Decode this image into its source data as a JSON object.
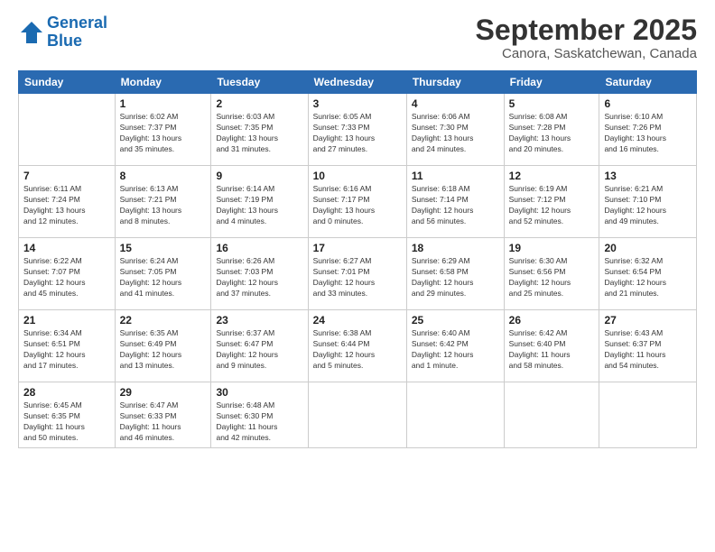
{
  "logo": {
    "line1": "General",
    "line2": "Blue"
  },
  "title": "September 2025",
  "location": "Canora, Saskatchewan, Canada",
  "weekdays": [
    "Sunday",
    "Monday",
    "Tuesday",
    "Wednesday",
    "Thursday",
    "Friday",
    "Saturday"
  ],
  "weeks": [
    [
      {
        "day": "",
        "info": ""
      },
      {
        "day": "1",
        "info": "Sunrise: 6:02 AM\nSunset: 7:37 PM\nDaylight: 13 hours\nand 35 minutes."
      },
      {
        "day": "2",
        "info": "Sunrise: 6:03 AM\nSunset: 7:35 PM\nDaylight: 13 hours\nand 31 minutes."
      },
      {
        "day": "3",
        "info": "Sunrise: 6:05 AM\nSunset: 7:33 PM\nDaylight: 13 hours\nand 27 minutes."
      },
      {
        "day": "4",
        "info": "Sunrise: 6:06 AM\nSunset: 7:30 PM\nDaylight: 13 hours\nand 24 minutes."
      },
      {
        "day": "5",
        "info": "Sunrise: 6:08 AM\nSunset: 7:28 PM\nDaylight: 13 hours\nand 20 minutes."
      },
      {
        "day": "6",
        "info": "Sunrise: 6:10 AM\nSunset: 7:26 PM\nDaylight: 13 hours\nand 16 minutes."
      }
    ],
    [
      {
        "day": "7",
        "info": "Sunrise: 6:11 AM\nSunset: 7:24 PM\nDaylight: 13 hours\nand 12 minutes."
      },
      {
        "day": "8",
        "info": "Sunrise: 6:13 AM\nSunset: 7:21 PM\nDaylight: 13 hours\nand 8 minutes."
      },
      {
        "day": "9",
        "info": "Sunrise: 6:14 AM\nSunset: 7:19 PM\nDaylight: 13 hours\nand 4 minutes."
      },
      {
        "day": "10",
        "info": "Sunrise: 6:16 AM\nSunset: 7:17 PM\nDaylight: 13 hours\nand 0 minutes."
      },
      {
        "day": "11",
        "info": "Sunrise: 6:18 AM\nSunset: 7:14 PM\nDaylight: 12 hours\nand 56 minutes."
      },
      {
        "day": "12",
        "info": "Sunrise: 6:19 AM\nSunset: 7:12 PM\nDaylight: 12 hours\nand 52 minutes."
      },
      {
        "day": "13",
        "info": "Sunrise: 6:21 AM\nSunset: 7:10 PM\nDaylight: 12 hours\nand 49 minutes."
      }
    ],
    [
      {
        "day": "14",
        "info": "Sunrise: 6:22 AM\nSunset: 7:07 PM\nDaylight: 12 hours\nand 45 minutes."
      },
      {
        "day": "15",
        "info": "Sunrise: 6:24 AM\nSunset: 7:05 PM\nDaylight: 12 hours\nand 41 minutes."
      },
      {
        "day": "16",
        "info": "Sunrise: 6:26 AM\nSunset: 7:03 PM\nDaylight: 12 hours\nand 37 minutes."
      },
      {
        "day": "17",
        "info": "Sunrise: 6:27 AM\nSunset: 7:01 PM\nDaylight: 12 hours\nand 33 minutes."
      },
      {
        "day": "18",
        "info": "Sunrise: 6:29 AM\nSunset: 6:58 PM\nDaylight: 12 hours\nand 29 minutes."
      },
      {
        "day": "19",
        "info": "Sunrise: 6:30 AM\nSunset: 6:56 PM\nDaylight: 12 hours\nand 25 minutes."
      },
      {
        "day": "20",
        "info": "Sunrise: 6:32 AM\nSunset: 6:54 PM\nDaylight: 12 hours\nand 21 minutes."
      }
    ],
    [
      {
        "day": "21",
        "info": "Sunrise: 6:34 AM\nSunset: 6:51 PM\nDaylight: 12 hours\nand 17 minutes."
      },
      {
        "day": "22",
        "info": "Sunrise: 6:35 AM\nSunset: 6:49 PM\nDaylight: 12 hours\nand 13 minutes."
      },
      {
        "day": "23",
        "info": "Sunrise: 6:37 AM\nSunset: 6:47 PM\nDaylight: 12 hours\nand 9 minutes."
      },
      {
        "day": "24",
        "info": "Sunrise: 6:38 AM\nSunset: 6:44 PM\nDaylight: 12 hours\nand 5 minutes."
      },
      {
        "day": "25",
        "info": "Sunrise: 6:40 AM\nSunset: 6:42 PM\nDaylight: 12 hours\nand 1 minute."
      },
      {
        "day": "26",
        "info": "Sunrise: 6:42 AM\nSunset: 6:40 PM\nDaylight: 11 hours\nand 58 minutes."
      },
      {
        "day": "27",
        "info": "Sunrise: 6:43 AM\nSunset: 6:37 PM\nDaylight: 11 hours\nand 54 minutes."
      }
    ],
    [
      {
        "day": "28",
        "info": "Sunrise: 6:45 AM\nSunset: 6:35 PM\nDaylight: 11 hours\nand 50 minutes."
      },
      {
        "day": "29",
        "info": "Sunrise: 6:47 AM\nSunset: 6:33 PM\nDaylight: 11 hours\nand 46 minutes."
      },
      {
        "day": "30",
        "info": "Sunrise: 6:48 AM\nSunset: 6:30 PM\nDaylight: 11 hours\nand 42 minutes."
      },
      {
        "day": "",
        "info": ""
      },
      {
        "day": "",
        "info": ""
      },
      {
        "day": "",
        "info": ""
      },
      {
        "day": "",
        "info": ""
      }
    ]
  ]
}
